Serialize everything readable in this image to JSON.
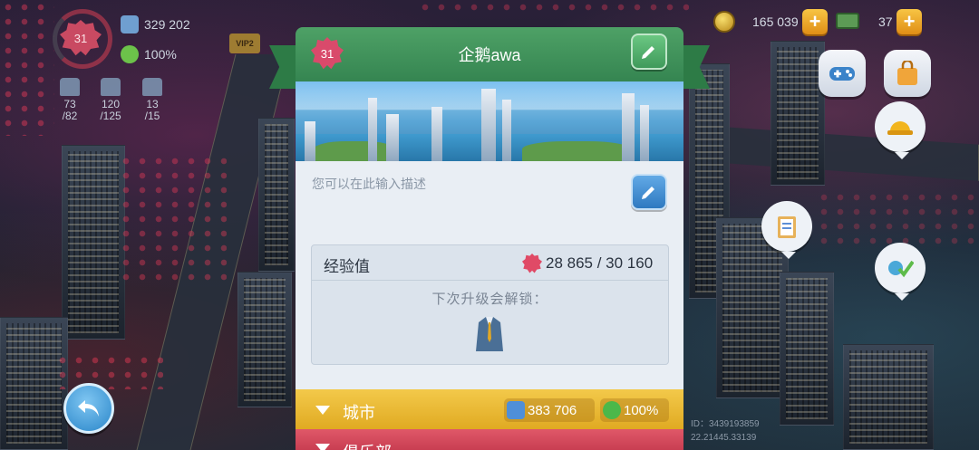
{
  "hud": {
    "level": "31",
    "population": "329 202",
    "happiness": "100%",
    "vip_label": "VIP2",
    "stats": [
      {
        "icon": "water-tank-icon",
        "value": "73",
        "max": "/82"
      },
      {
        "icon": "power-tank-icon",
        "value": "120",
        "max": "/125"
      },
      {
        "icon": "sewage-tank-icon",
        "value": "13",
        "max": "/15"
      }
    ],
    "simoleons": "165 039",
    "simcash": "37"
  },
  "profile": {
    "level": "31",
    "player_name": "企鹅awa",
    "description_placeholder": "您可以在此输入描述",
    "xp_label": "经验值",
    "xp_value": "28 865 / 30 160",
    "next_unlock_label": "下次升级会解锁：",
    "unlock_item_icon": "business-suit-icon"
  },
  "sections": {
    "city": {
      "label": "城市",
      "population": "383 706",
      "happiness": "100%"
    },
    "club": {
      "label": "俱乐部"
    }
  },
  "footer": {
    "id_line1": "ID：3439193859",
    "id_line2": "22.21445.33139"
  },
  "colors": {
    "header_green": "#358551",
    "city_yellow": "#e0aa22",
    "club_red": "#c93e52",
    "level_badge": "#d94a6b"
  }
}
